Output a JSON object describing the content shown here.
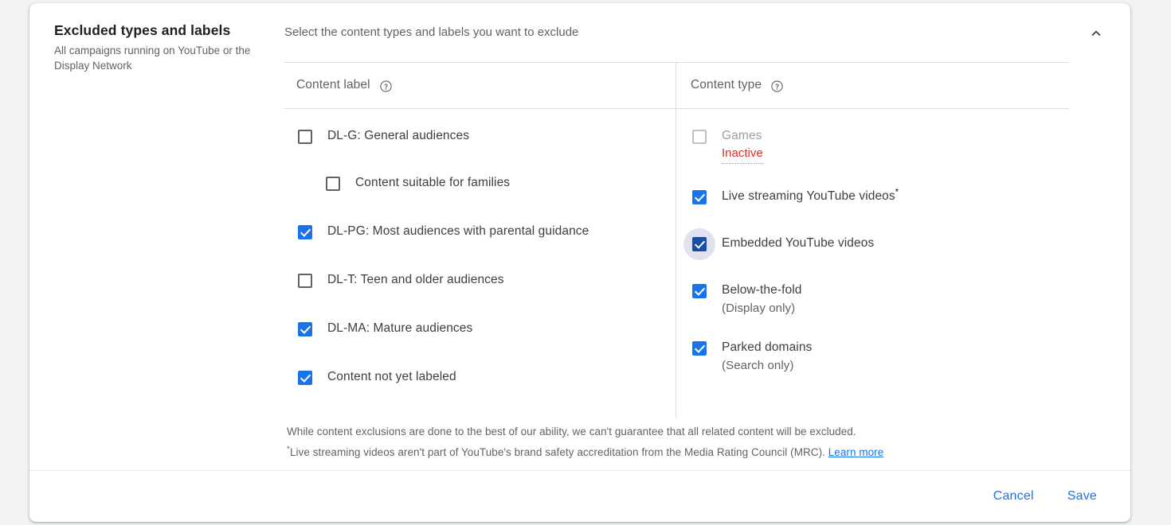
{
  "card": {
    "title": "Excluded types and labels",
    "subtitle": "All campaigns running on YouTube or the Display Network",
    "intro": "Select the content types and labels you want to exclude",
    "collapse_icon": "chevron-up-icon"
  },
  "columns": {
    "label": {
      "header": "Content label",
      "help_icon": "help-circle-icon",
      "items": [
        {
          "label": "DL-G: General audiences",
          "checked": false,
          "indent": false
        },
        {
          "label": "Content suitable for families",
          "checked": false,
          "indent": true
        },
        {
          "label": "DL-PG: Most audiences with parental guidance",
          "checked": true,
          "indent": false
        },
        {
          "label": "DL-T: Teen and older audiences",
          "checked": false,
          "indent": false
        },
        {
          "label": "DL-MA: Mature audiences",
          "checked": true,
          "indent": false
        },
        {
          "label": "Content not yet labeled",
          "checked": true,
          "indent": false
        }
      ]
    },
    "type": {
      "header": "Content type",
      "help_icon": "help-circle-icon",
      "items": [
        {
          "label": "Games",
          "checked": false,
          "disabled": true,
          "status": "Inactive"
        },
        {
          "label": "Live streaming YouTube videos",
          "checked": true,
          "superscript": "*"
        },
        {
          "label": "Embedded YouTube videos",
          "checked": true,
          "focused": true
        },
        {
          "label": "Below-the-fold",
          "checked": true,
          "sub": "(Display only)"
        },
        {
          "label": "Parked domains",
          "checked": true,
          "sub": "(Search only)"
        }
      ]
    }
  },
  "disclaimer": {
    "line1": "While content exclusions are done to the best of our ability, we can't guarantee that all related content will be excluded.",
    "marker": "*",
    "line2": "Live streaming videos aren't part of YouTube's brand safety accreditation from the Media Rating Council (MRC). ",
    "link": "Learn more"
  },
  "footer": {
    "cancel": "Cancel",
    "save": "Save"
  },
  "colors": {
    "accent": "#1a73e8",
    "accent_pressed": "#174ea6",
    "focus_ring": "#dfe3f0",
    "error": "#d93025",
    "text_primary": "#202124",
    "text_secondary": "#5f6368",
    "divider": "#dadce0",
    "page_bg": "#f1f3f4"
  }
}
